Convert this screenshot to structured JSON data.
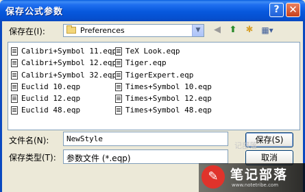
{
  "dialog": {
    "title": "保存公式参数",
    "help_label": "?",
    "close_label": "✕"
  },
  "location": {
    "label": "保存在(I):",
    "folder": "Preferences"
  },
  "toolbar": {
    "back_icon": "back-icon",
    "up_icon": "up-folder-icon",
    "new_folder_icon": "new-folder-icon",
    "views_icon": "views-menu-icon"
  },
  "files": {
    "col1": [
      "Calibri+Symbol 11.eqp",
      "Calibri+Symbol 12.eqp",
      "Calibri+Symbol 32.eqp",
      "Euclid 10.eqp",
      "Euclid 12.eqp",
      "Euclid 48.eqp"
    ],
    "col2": [
      "TeX Look.eqp",
      "Tiger.eqp",
      "TigerExpert.eqp",
      "Times+Symbol 10.eqp",
      "Times+Symbol 12.eqp",
      "Times+Symbol 48.eqp"
    ]
  },
  "filename": {
    "label": "文件名(N):",
    "value": "NewStyle"
  },
  "filetype": {
    "label": "保存类型(T):",
    "value": "参数文件 (*.eqp)"
  },
  "buttons": {
    "save": "保存(S)",
    "cancel": "取消"
  },
  "watermark": {
    "logo": "✎",
    "title": "笔记部落",
    "url": "www.notetribe.com",
    "faint_text": "记部落"
  }
}
